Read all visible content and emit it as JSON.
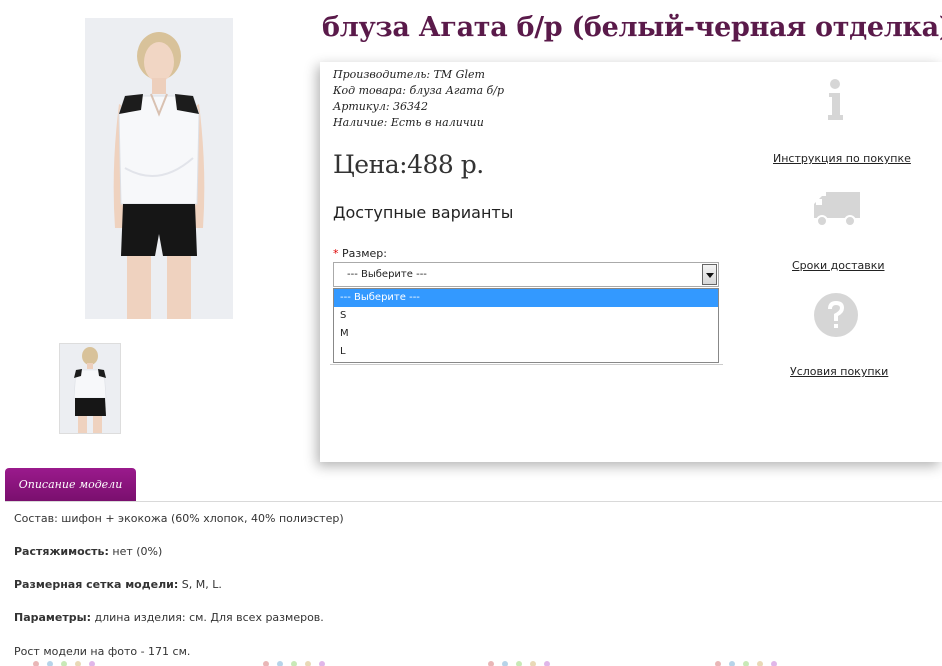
{
  "product": {
    "title": "блуза Агата б/р (белый-черная отделка)",
    "specs": [
      {
        "label": "Производитель:",
        "value": "ТМ Glem"
      },
      {
        "label": "Код товара:",
        "value": "блуза Агата б/р"
      },
      {
        "label": "Артикул:",
        "value": "36342"
      },
      {
        "label": "Наличие:",
        "value": "Есть в наличии"
      }
    ],
    "price": "Цена:488 р.",
    "variants_heading": "Доступные варианты",
    "size_required_mark": "*",
    "size_label": "Размер:",
    "size_select_value": "--- Выберите ---",
    "size_options": [
      "--- Выберите ---",
      "S",
      "M",
      "L"
    ],
    "size_selected_index": 0
  },
  "sidebar": {
    "links": [
      {
        "label": "Инструкция по покупке",
        "icon": "info-icon"
      },
      {
        "label": "Сроки доставки",
        "icon": "truck-icon"
      },
      {
        "label": "Условия покупки",
        "icon": "question-icon"
      }
    ]
  },
  "tabs": {
    "description": "Описание модели"
  },
  "description": {
    "lines": [
      {
        "bold": "",
        "text": "Состав: шифон + экокожа (60% хлопок, 40% полиэстер)"
      },
      {
        "bold": "Растяжимость:",
        "text": " нет (0%)"
      },
      {
        "bold": "Размерная сетка модели:",
        "text": " S, M, L."
      },
      {
        "bold": "Параметры:",
        "text": " длина изделия:  см.  Для всех размеров."
      },
      {
        "bold": "",
        "text": "Рост модели на фото - 171 см."
      }
    ]
  },
  "colors": {
    "title": "#5a1a4a",
    "tab": "#8a1580",
    "dropdown_selected": "#3399ff",
    "icon_gray": "#d6d6d6"
  }
}
